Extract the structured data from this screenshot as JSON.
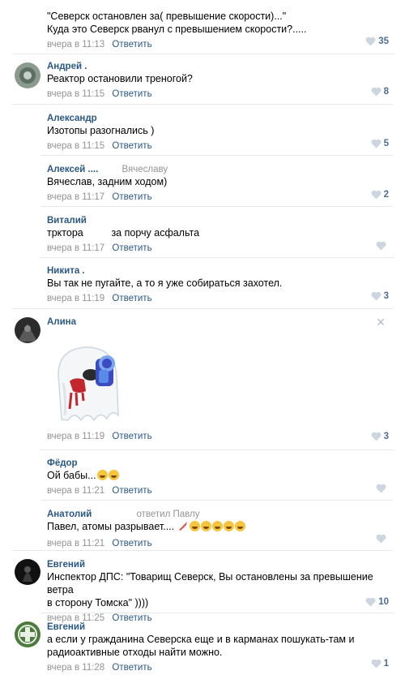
{
  "comments": [
    {
      "author": "",
      "text_lines": [
        "\"Северск остановлен за( превышение скорости)...\"",
        "Куда это Северск рванул с превышением скорости?....."
      ],
      "time": "вчера в 11:13",
      "reply_label": "Ответить",
      "likes": "35"
    },
    {
      "author": "Андрей .",
      "text_lines": [
        "Реактор остановили треногой?"
      ],
      "time": "вчера в 11:15",
      "reply_label": "Ответить",
      "likes": "8"
    },
    {
      "author": "Александр",
      "text_lines": [
        "Изотопы разогнались )"
      ],
      "time": "вчера в 11:15",
      "reply_label": "Ответить",
      "likes": "5"
    },
    {
      "author": "Алексей ....",
      "replied_to": "Вячеславу",
      "text_lines": [
        "Вячеслав, задним ходом)"
      ],
      "time": "вчера в 11:17",
      "reply_label": "Ответить",
      "likes": "2"
    },
    {
      "author": "Виталий",
      "text_lines": [
        "трктора          за порчу асфальта"
      ],
      "time": "вчера в 11:17",
      "reply_label": "Ответить",
      "likes": ""
    },
    {
      "author": "Никита .",
      "text_lines": [
        "Вы так не пугайте, а то я уже собираться захотел."
      ],
      "time": "вчера в 11:19",
      "reply_label": "Ответить",
      "likes": "3"
    },
    {
      "author": "Алина",
      "text_lines": [],
      "time": "вчера в 11:19",
      "reply_label": "Ответить",
      "likes": "3",
      "close": "✕"
    },
    {
      "author": "Фёдор",
      "text_lines": [
        "Ой бабы..."
      ],
      "time": "вчера в 11:21",
      "reply_label": "Ответить",
      "likes": ""
    },
    {
      "author": "Анатолий",
      "replied_to": "ответил Павлу",
      "text_lines": [
        "Павел, атомы разрывает...."
      ],
      "time": "вчера в 11:21",
      "reply_label": "Ответить",
      "likes": ""
    },
    {
      "author": "Евгений",
      "text_lines": [
        "Инспектор ДПС: \"Товарищ Северск, Вы остановлены за превышение ветра",
        "в сторону Томска\" ))))"
      ],
      "time": "вчера в 11:25",
      "reply_label": "Ответить",
      "likes": "10"
    },
    {
      "author": "Евгений",
      "text_lines": [
        "а если у гражданина Северска еще и в карманах пошукать-там и",
        "радиоактивные отходы найти можно."
      ],
      "time": "вчера в 11:28",
      "reply_label": "Ответить",
      "likes": "1"
    }
  ],
  "colors": {
    "link": "#2a5885",
    "meta": "#939393",
    "divider": "#e7e8ec",
    "like": "#4c6f94"
  }
}
